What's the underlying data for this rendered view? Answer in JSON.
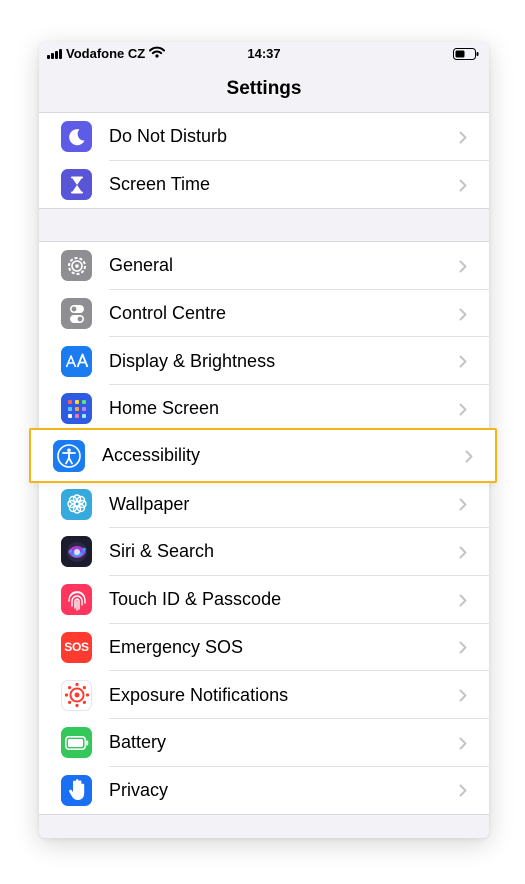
{
  "status_bar": {
    "carrier": "Vodafone CZ",
    "time": "14:37"
  },
  "nav": {
    "title": "Settings"
  },
  "group1": [
    {
      "label": "Do Not Disturb",
      "icon": "moon-icon",
      "color": "#5e5ce6"
    },
    {
      "label": "Screen Time",
      "icon": "hourglass-icon",
      "color": "#5856d6"
    }
  ],
  "group2": [
    {
      "label": "General",
      "icon": "gear-icon",
      "color": "#8e8e93"
    },
    {
      "label": "Control Centre",
      "icon": "toggles-icon",
      "color": "#8e8e93"
    },
    {
      "label": "Display & Brightness",
      "icon": "text-size-icon",
      "color": "#1b7cf2"
    },
    {
      "label": "Home Screen",
      "icon": "app-grid-icon",
      "color": "#2f5be0"
    },
    {
      "label": "Accessibility",
      "icon": "accessibility-icon",
      "color": "#1b7cf2",
      "highlighted": true
    },
    {
      "label": "Wallpaper",
      "icon": "flower-icon",
      "color": "#35aadc"
    },
    {
      "label": "Siri & Search",
      "icon": "siri-icon",
      "color": "#1c1c2e"
    },
    {
      "label": "Touch ID & Passcode",
      "icon": "fingerprint-icon",
      "color": "#ff375f"
    },
    {
      "label": "Emergency SOS",
      "icon": "sos-icon",
      "color": "#ff3b30",
      "icon_text": "SOS"
    },
    {
      "label": "Exposure Notifications",
      "icon": "exposure-icon",
      "color": "#ffffff"
    },
    {
      "label": "Battery",
      "icon": "battery-icon",
      "color": "#34c759"
    },
    {
      "label": "Privacy",
      "icon": "hand-icon",
      "color": "#1b6ff2"
    }
  ],
  "highlight_color": "#f4b41a"
}
